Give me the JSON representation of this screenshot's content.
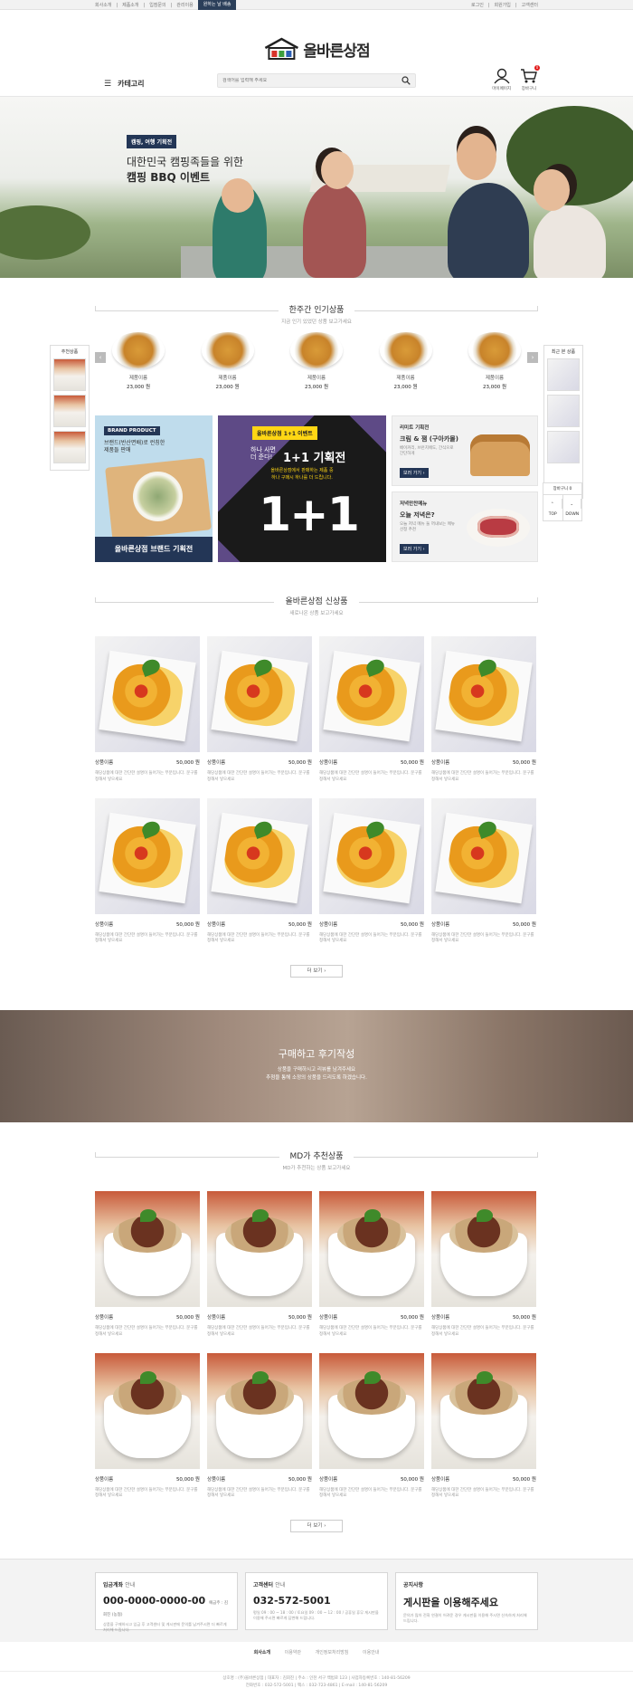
{
  "topbar": {
    "left_links": [
      "회사소개",
      "제품소개",
      "입점문의",
      "관리이용"
    ],
    "highlight": "원하는 날 배송",
    "right_links": [
      "로그인",
      "회원가입",
      "고객센터"
    ]
  },
  "header": {
    "logo_text": "올바른상점",
    "category_label": "카테고리",
    "search_placeholder": "검색어를 입력해 주세요",
    "mypage_label": "마이페이지",
    "cart_label": "장바구니",
    "cart_count": "0"
  },
  "hero": {
    "tag": "캠핑, 여행 기획전",
    "subtitle": "대한민국 캠핑족들을 위한",
    "title": "캠핑 BBQ 이벤트"
  },
  "weekly": {
    "title": "한주간 인기상품",
    "subtitle": "지금 인기 있었던 상품 보고가세요",
    "left_box_title": "추천상품",
    "right_box_title": "최근 본 상품",
    "items": [
      {
        "name": "제품이름",
        "price": "23,000 원"
      },
      {
        "name": "제품이름",
        "price": "23,000 원"
      },
      {
        "name": "제품이름",
        "price": "23,000 원"
      },
      {
        "name": "제품이름",
        "price": "23,000 원"
      },
      {
        "name": "제품이름",
        "price": "23,000 원"
      }
    ]
  },
  "quick": {
    "cart": "장바구니 0",
    "top": "TOP",
    "down": "DOWN"
  },
  "banners": {
    "brand": {
      "tag": "BRAND PRODUCT",
      "text1": "브랜드(반산면배)로 런칭한",
      "text2": "제품들 판매",
      "caption": "올바른상점 브랜드 기획전"
    },
    "one_plus_one": {
      "tag": "올바른상점 1+1 이벤트",
      "line1": "하나 사면",
      "line2": "더 준다!",
      "headline": "1+1 기획전",
      "desc1": "올바른상점에서 판매하는 제품 중",
      "desc2": "하나 구매시 하나를 더 드립니다.",
      "big": "1+1"
    },
    "limited": {
      "label": "리미트 기획전",
      "title": "크림 & 잼 (구아카몰)",
      "desc": "베이커리, 브런치에도, 간식으로 간단하게",
      "more": "보러 가기"
    },
    "dinner": {
      "label": "저녁만찬메뉴",
      "title": "오늘 저녁은?",
      "desc": "오늘 저녁 메뉴 둘 꺼내보는 메뉴 선정 추천",
      "more": "보러 가기"
    }
  },
  "new_products": {
    "title": "올바른상점 신상품",
    "subtitle": "새로나온 상품 보고가세요",
    "more": "더 보기",
    "items": [
      {
        "name": "상품이름",
        "price": "50,000 원",
        "desc": "해당상품에 대한 간단한 설명이 들어가는 부분입니다. 문구를 정해서 넣으세요"
      },
      {
        "name": "상품이름",
        "price": "50,000 원",
        "desc": "해당상품에 대한 간단한 설명이 들어가는 부분입니다. 문구를 정해서 넣으세요"
      },
      {
        "name": "상품이름",
        "price": "50,000 원",
        "desc": "해당상품에 대한 간단한 설명이 들어가는 부분입니다. 문구를 정해서 넣으세요"
      },
      {
        "name": "상품이름",
        "price": "50,000 원",
        "desc": "해당상품에 대한 간단한 설명이 들어가는 부분입니다. 문구를 정해서 넣으세요"
      },
      {
        "name": "상품이름",
        "price": "50,000 원",
        "desc": "해당상품에 대한 간단한 설명이 들어가는 부분입니다. 문구를 정해서 넣으세요"
      },
      {
        "name": "상품이름",
        "price": "50,000 원",
        "desc": "해당상품에 대한 간단한 설명이 들어가는 부분입니다. 문구를 정해서 넣으세요"
      },
      {
        "name": "상품이름",
        "price": "50,000 원",
        "desc": "해당상품에 대한 간단한 설명이 들어가는 부분입니다. 문구를 정해서 넣으세요"
      },
      {
        "name": "상품이름",
        "price": "50,000 원",
        "desc": "해당상품에 대한 간단한 설명이 들어가는 부분입니다. 문구를 정해서 넣으세요"
      }
    ]
  },
  "review": {
    "title": "구매하고 후기작성",
    "line1": "상품을 구매하시고 리뷰를 남겨주세요",
    "line2": "추첨을 통해 소정의 상품을 드리도록 하겠습니다."
  },
  "md_products": {
    "title": "MD가 추천상품",
    "subtitle": "MD가 추천하는 상품 보고가세요",
    "more": "더 보기",
    "items": [
      {
        "name": "상품이름",
        "price": "50,000 원",
        "desc": "해당상품에 대한 간단한 설명이 들어가는 부분입니다. 문구를 정해서 넣으세요"
      },
      {
        "name": "상품이름",
        "price": "50,000 원",
        "desc": "해당상품에 대한 간단한 설명이 들어가는 부분입니다. 문구를 정해서 넣으세요"
      },
      {
        "name": "상품이름",
        "price": "50,000 원",
        "desc": "해당상품에 대한 간단한 설명이 들어가는 부분입니다. 문구를 정해서 넣으세요"
      },
      {
        "name": "상품이름",
        "price": "50,000 원",
        "desc": "해당상품에 대한 간단한 설명이 들어가는 부분입니다. 문구를 정해서 넣으세요"
      },
      {
        "name": "상품이름",
        "price": "50,000 원",
        "desc": "해당상품에 대한 간단한 설명이 들어가는 부분입니다. 문구를 정해서 넣으세요"
      },
      {
        "name": "상품이름",
        "price": "50,000 원",
        "desc": "해당상품에 대한 간단한 설명이 들어가는 부분입니다. 문구를 정해서 넣으세요"
      },
      {
        "name": "상품이름",
        "price": "50,000 원",
        "desc": "해당상품에 대한 간단한 설명이 들어가는 부분입니다. 문구를 정해서 넣으세요"
      },
      {
        "name": "상품이름",
        "price": "50,000 원",
        "desc": "해당상품에 대한 간단한 설명이 들어가는 부분입니다. 문구를 정해서 넣으세요"
      }
    ]
  },
  "footer": {
    "bank": {
      "title": "입금계좌",
      "title_sub": "안내",
      "number": "000-0000-0000-00",
      "holder": "예금주 : 김회진 (농협)",
      "note": "상품을 구매하시고 입금 후 고객센터 및 게시판에 문의를 남겨주시면 더 빠르게 처리해 드립니다."
    },
    "center": {
      "title": "고객센터",
      "title_sub": "안내",
      "number": "032-572-5001",
      "note": "평일 09 : 00 ~ 18 : 00 / 토요일 09 : 00 ~ 12 : 00 / 공휴일 휴무 게시판을 이용해 주시면 빠르게 답변해 드립니다."
    },
    "notice": {
      "title": "공지사항",
      "headline": "게시판을 이용해주세요",
      "note": "문의가 많아 전화 연결이 어려운 경우 게시판을 이용해 주시면 신속하게 처리해 드립니다."
    },
    "links": [
      "회사소개",
      "이용약관",
      "개인정보처리방침",
      "이용안내"
    ],
    "copy1": "상호명 : (주)올바른상점  |  대표자 : 김회진  |  주소 : 인천 서구 백범로 123  |  사업자등록번호 : 140-81-56209",
    "copy2": "전화번호 : 032-572-5001  |  팩스 : 032-723-4861  |  E-mail : 140-81-56209"
  },
  "colors": {
    "navy": "#233656",
    "purple": "#5e4a86",
    "yellow": "#ffd614",
    "badge_red": "#e21a1a"
  }
}
